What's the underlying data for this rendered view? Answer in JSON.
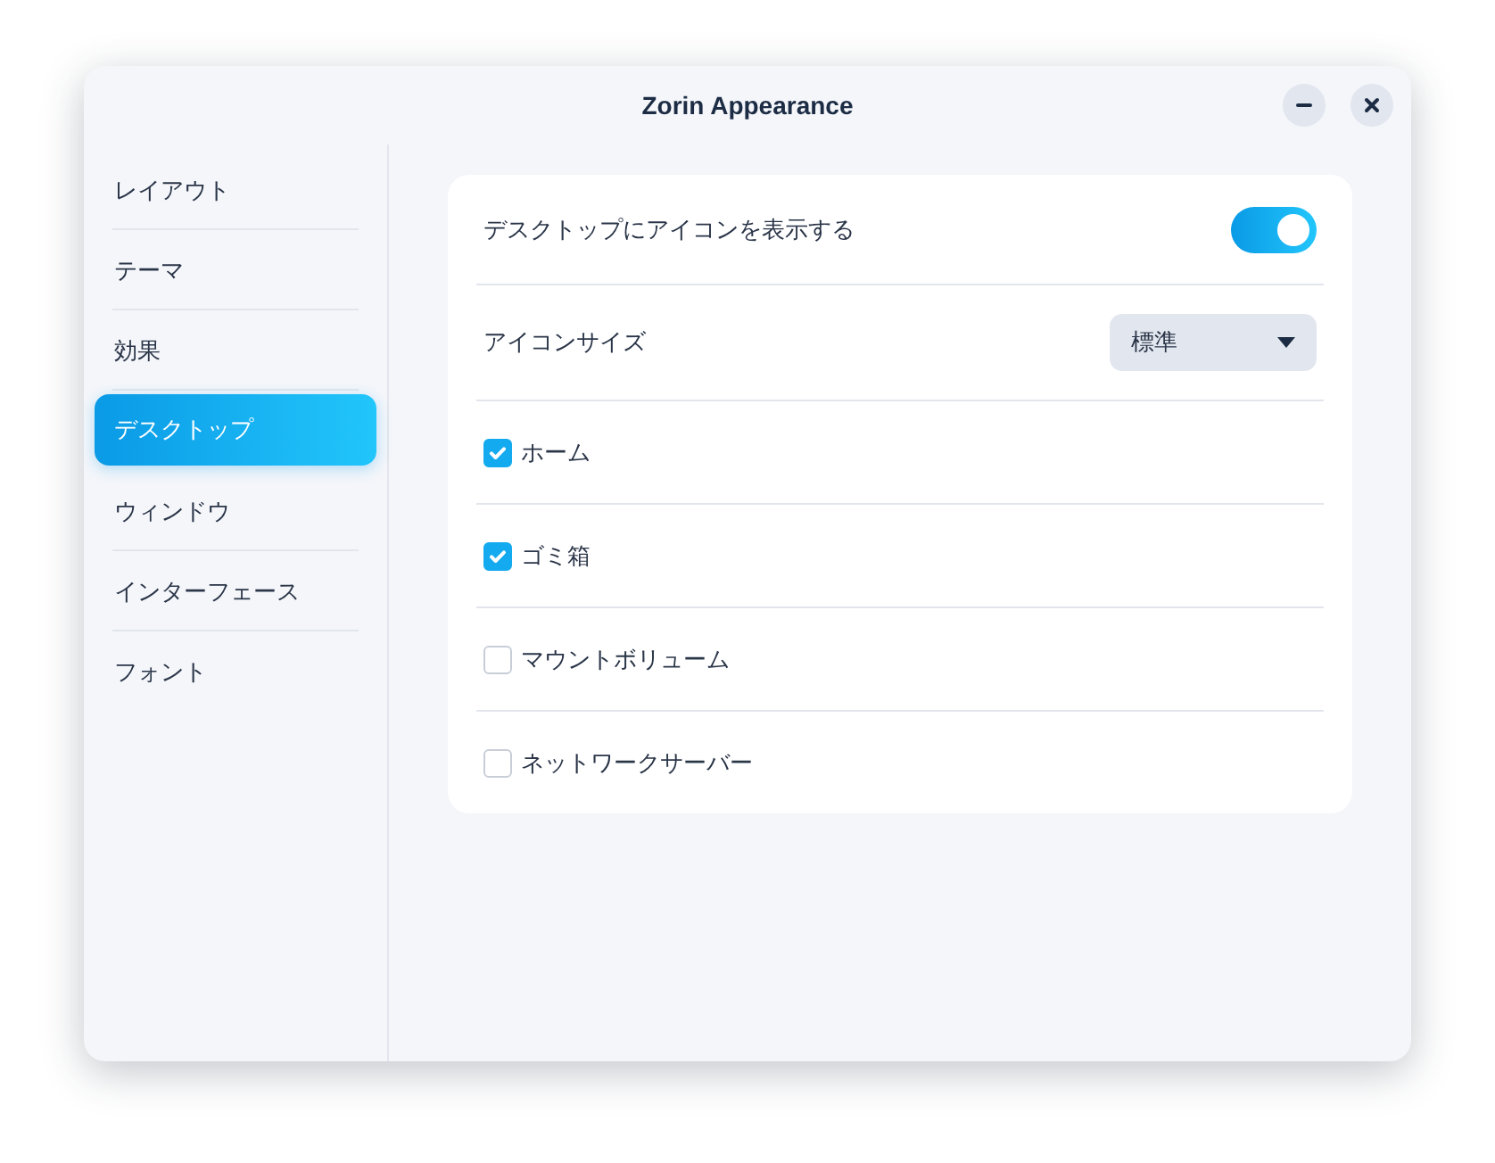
{
  "window": {
    "title": "Zorin Appearance",
    "controls": [
      {
        "kind": "minimize"
      },
      {
        "kind": "close"
      }
    ]
  },
  "sidebar": {
    "items": [
      {
        "label": "レイアウト",
        "selected": false
      },
      {
        "label": "テーマ",
        "selected": false
      },
      {
        "label": "効果",
        "selected": false
      },
      {
        "label": "デスクトップ",
        "selected": true
      },
      {
        "label": "ウィンドウ",
        "selected": false
      },
      {
        "label": "インターフェース",
        "selected": false
      },
      {
        "label": "フォント",
        "selected": false
      }
    ]
  },
  "settings": [
    {
      "kind": "switch",
      "label": "デスクトップにアイコンを表示する",
      "on": true
    },
    {
      "kind": "dropdown",
      "label": "アイコンサイズ",
      "value": "標準"
    },
    {
      "kind": "checkbox",
      "label": "ホーム",
      "checked": true
    },
    {
      "kind": "checkbox",
      "label": "ゴミ箱",
      "checked": true
    },
    {
      "kind": "checkbox",
      "label": "マウントボリューム",
      "checked": false
    },
    {
      "kind": "checkbox",
      "label": "ネットワークサーバー",
      "checked": false
    }
  ]
}
